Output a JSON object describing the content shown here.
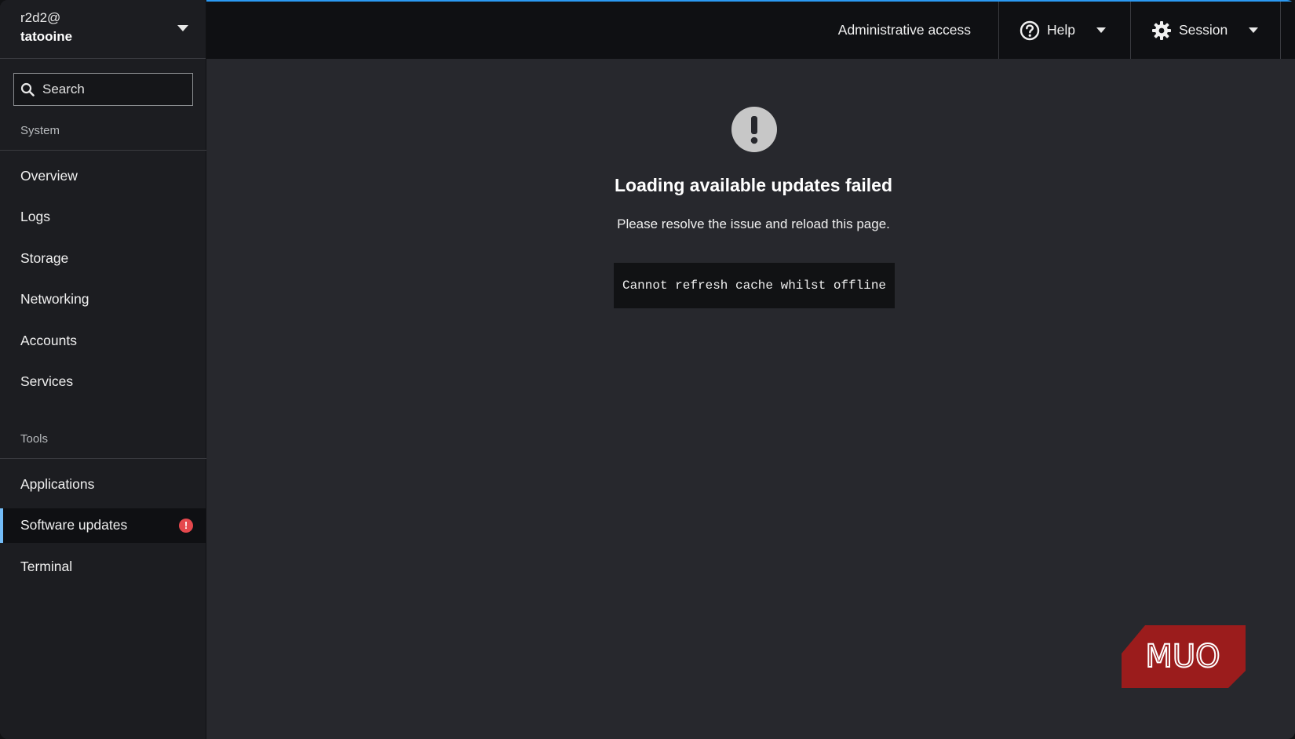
{
  "host": {
    "user": "r2d2@",
    "name": "tatooine"
  },
  "search": {
    "placeholder": "Search"
  },
  "sidebar": {
    "system_title": "System",
    "system_items": [
      {
        "label": "Overview"
      },
      {
        "label": "Logs"
      },
      {
        "label": "Storage"
      },
      {
        "label": "Networking"
      },
      {
        "label": "Accounts"
      },
      {
        "label": "Services"
      }
    ],
    "tools_title": "Tools",
    "tools_items": [
      {
        "label": "Applications"
      },
      {
        "label": "Software updates",
        "active": true,
        "badge": "!"
      },
      {
        "label": "Terminal"
      }
    ]
  },
  "topbar": {
    "admin_label": "Administrative access",
    "help_label": "Help",
    "session_label": "Session"
  },
  "main": {
    "title": "Loading available updates failed",
    "body": "Please resolve the issue and reload this page.",
    "error": "Cannot refresh cache whilst offline"
  },
  "watermark": {
    "text": "MUO"
  },
  "colors": {
    "accent": "#2b9af3",
    "active_border": "#73bcf7",
    "badge": "#e5484d",
    "logo": "#9b1c1c"
  },
  "icons": {
    "search": "search-icon",
    "help": "question-circle-icon",
    "session": "gear-icon",
    "alert": "exclamation-circle-icon"
  }
}
